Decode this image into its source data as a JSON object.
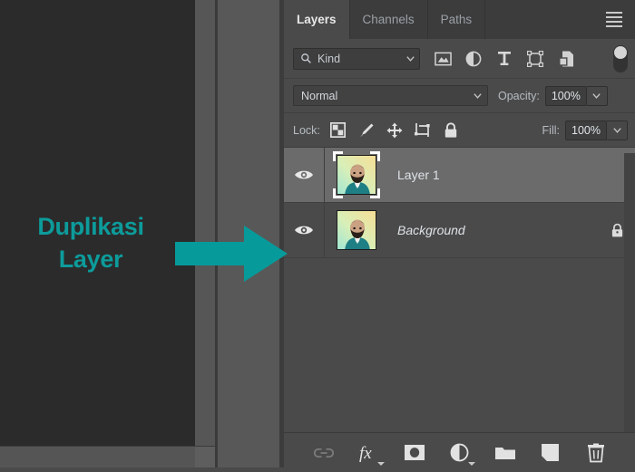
{
  "annotation": {
    "line1": "Duplikasi",
    "line2": "Layer",
    "color": "#0d9b9b",
    "arrow_icon": "right-arrow-icon"
  },
  "panel": {
    "tabs": [
      {
        "label": "Layers",
        "active": true
      },
      {
        "label": "Channels",
        "active": false
      },
      {
        "label": "Paths",
        "active": false
      }
    ],
    "menu_icon": "hamburger-menu-icon"
  },
  "filter": {
    "search_icon": "search-icon",
    "kind_value": "Kind",
    "kind_chevron": "chevron-down-icon",
    "icons": [
      "image-filter-icon",
      "adjustment-filter-icon",
      "type-filter-icon",
      "shape-filter-icon",
      "smart-object-filter-icon"
    ],
    "toggle": "filter-enable-toggle"
  },
  "blend": {
    "mode_value": "Normal",
    "mode_chevron": "chevron-down-icon",
    "opacity_label": "Opacity:",
    "opacity_value": "100%",
    "opacity_chevron": "chevron-down-icon"
  },
  "lock": {
    "label": "Lock:",
    "icons": [
      "transparency-lock-icon",
      "image-pixels-lock-icon",
      "position-lock-icon",
      "artboard-lock-icon",
      "lock-all-icon"
    ],
    "fill_label": "Fill:",
    "fill_value": "100%",
    "fill_chevron": "chevron-down-icon"
  },
  "layers": [
    {
      "name": "Layer 1",
      "selected": true,
      "italic": false,
      "visible": true,
      "locked": false,
      "eye_icon": "eye-icon",
      "thumbnail": "portrait-thumbnail"
    },
    {
      "name": "Background",
      "selected": false,
      "italic": true,
      "visible": true,
      "locked": true,
      "eye_icon": "eye-icon",
      "thumbnail": "portrait-thumbnail",
      "lock_icon": "lock-icon"
    }
  ],
  "bottom_toolbar": [
    {
      "name": "link-layers-icon",
      "dimmed": true
    },
    {
      "name": "layer-style-fx-icon",
      "dimmed": false
    },
    {
      "name": "layer-mask-icon",
      "dimmed": false
    },
    {
      "name": "adjustment-layer-icon",
      "dimmed": false
    },
    {
      "name": "new-group-icon",
      "dimmed": false
    },
    {
      "name": "new-layer-icon",
      "dimmed": false
    },
    {
      "name": "delete-layer-icon",
      "dimmed": false
    }
  ]
}
